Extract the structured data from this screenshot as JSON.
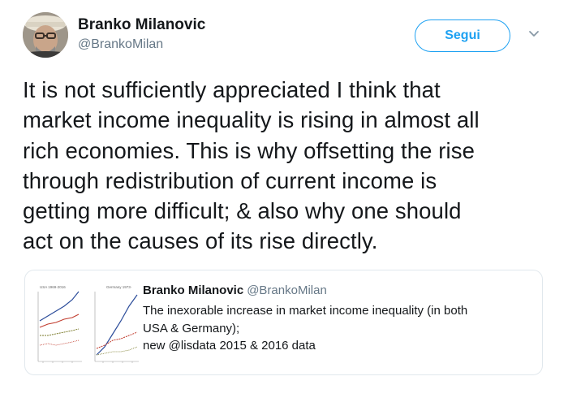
{
  "author": {
    "name": "Branko Milanovic",
    "handle": "@BrankoMilan"
  },
  "follow_button": {
    "label": "Segui"
  },
  "tweet": {
    "lines": [
      "It is not sufficiently appreciated I think that",
      "market income inequality is rising in almost all",
      "rich economies. This is why offsetting the rise",
      "through redistribution of current income is",
      "getting more difficult;  & also why one should",
      "act on the causes of its rise directly."
    ]
  },
  "quoted_tweet": {
    "name": "Branko Milanovic",
    "handle": "@BrankoMilan",
    "lines": [
      "The inexorable increase in market income inequality (in both",
      "USA & Germany);",
      "new @lisdata 2015 & 2016 data"
    ],
    "thumbnail": {
      "left_panel_title": "USA 1969-2016",
      "right_panel_title": "Germany 1973-"
    }
  },
  "colors": {
    "accent": "#1da1f2",
    "text": "#14171a",
    "secondary": "#657786",
    "border": "#e1e8ed"
  },
  "icons": {
    "more": "chevron-down-icon",
    "avatar": "avatar"
  }
}
